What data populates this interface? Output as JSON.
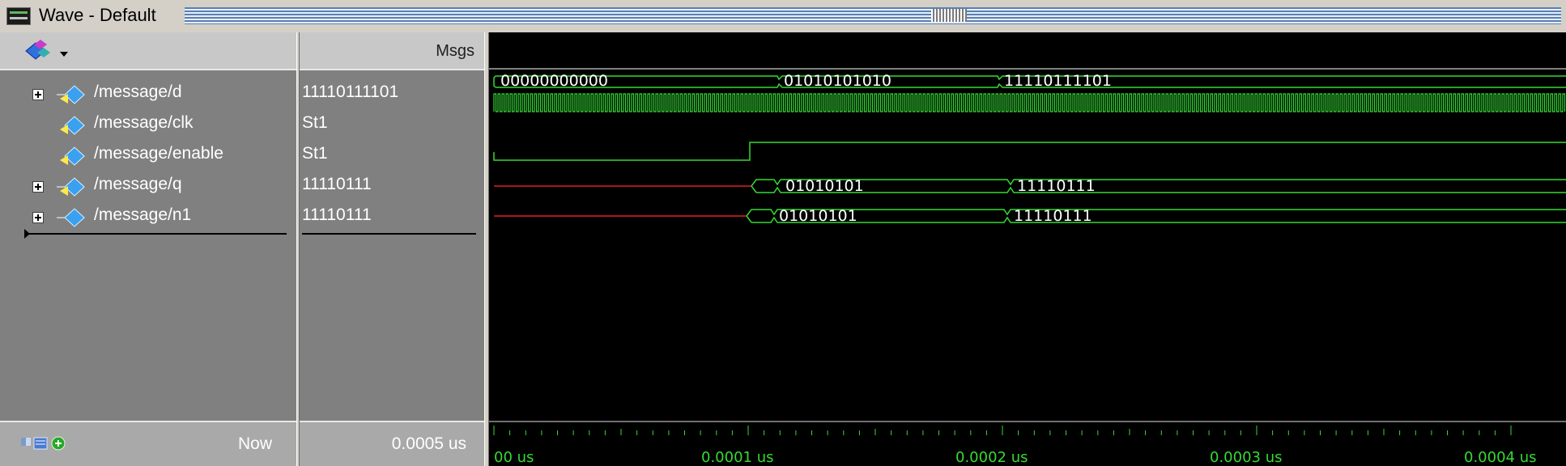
{
  "window": {
    "title": "Wave - Default"
  },
  "header": {
    "msgs_label": "Msgs",
    "toolbar_icon": "wave-signals-icon"
  },
  "signals": [
    {
      "name": "/message/d",
      "value": "11110111101",
      "expandable": true
    },
    {
      "name": "/message/clk",
      "value": "St1",
      "expandable": false
    },
    {
      "name": "/message/enable",
      "value": "St1",
      "expandable": false
    },
    {
      "name": "/message/q",
      "value": "11110111",
      "expandable": true
    },
    {
      "name": "/message/n1",
      "value": "11110111",
      "expandable": true
    }
  ],
  "waveforms": {
    "d": [
      "00000000000",
      "01010101010",
      "11110111101"
    ],
    "q": [
      "01010101",
      "11110111"
    ],
    "n1": [
      "01010101",
      "11110111"
    ]
  },
  "footer": {
    "now_label": "Now",
    "now_value": "0.0005 us",
    "timeline_labels": [
      "00 us",
      "0.0001 us",
      "0.0002 us",
      "0.0003 us",
      "0.0004 us"
    ]
  },
  "colors": {
    "signal": "#35d935",
    "undefined": "#e02020",
    "background": "#000000",
    "panel": "#808080"
  }
}
